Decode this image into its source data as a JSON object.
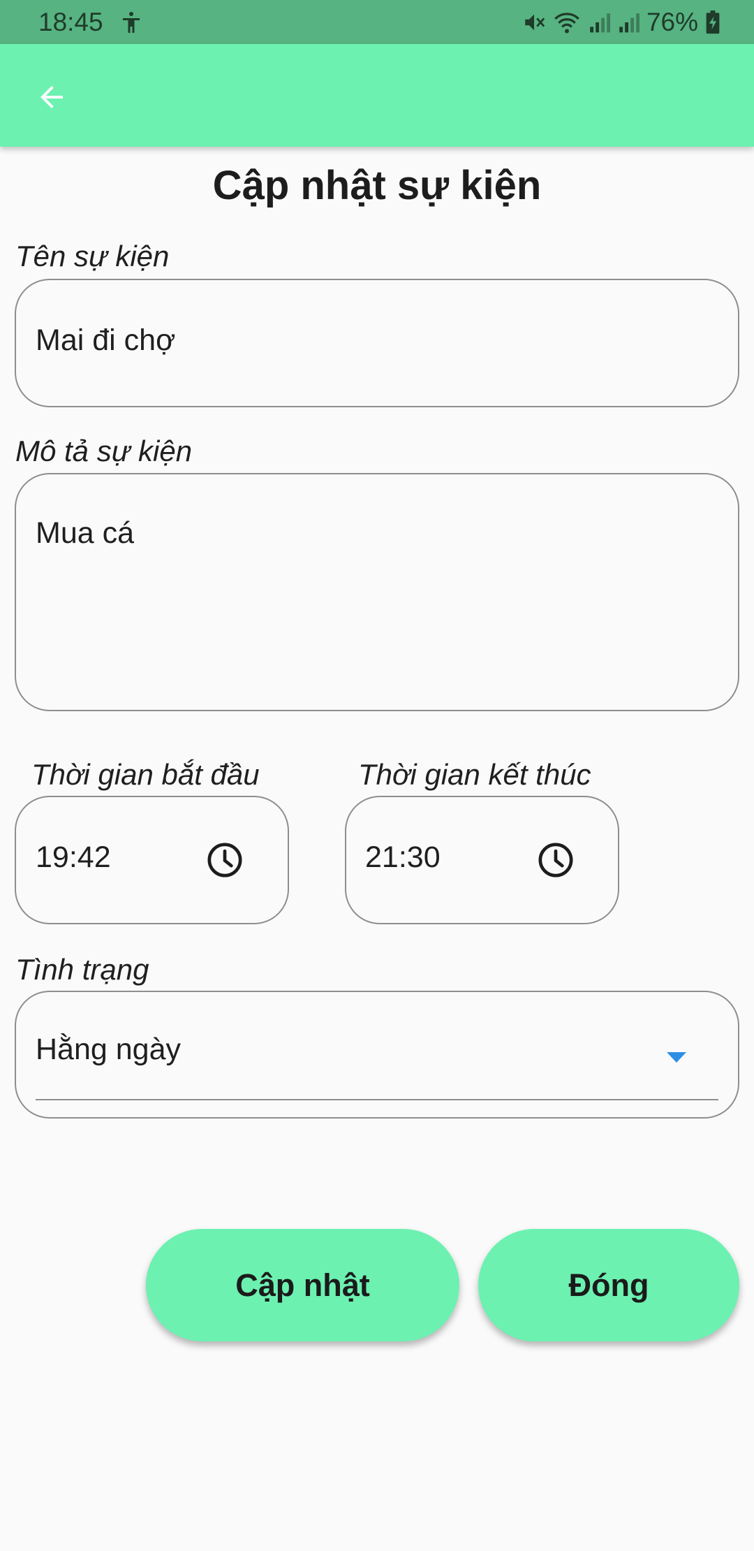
{
  "status_bar": {
    "time": "18:45",
    "battery": "76%"
  },
  "app_bar": {
    "back_icon": "arrow-back-icon"
  },
  "page": {
    "title": "Cập nhật sự kiện"
  },
  "form": {
    "name": {
      "label": "Tên sự kiện",
      "value": "Mai đi chợ"
    },
    "description": {
      "label": "Mô tả sự kiện",
      "value": "Mua cá"
    },
    "start_time": {
      "label": "Thời gian bắt đầu",
      "value": "19:42",
      "icon": "clock-icon"
    },
    "end_time": {
      "label": "Thời gian kết thúc",
      "value": "21:30",
      "icon": "clock-icon"
    },
    "status": {
      "label": "Tình trạng",
      "selected": "Hằng ngày"
    }
  },
  "buttons": {
    "update": "Cập nhật",
    "close": "Đóng"
  },
  "colors": {
    "accent": "#6cf1b1",
    "status_bar": "#57b381",
    "dropdown_arrow": "#2f8ee6",
    "border": "#8e8e8e",
    "background": "#fafafa"
  }
}
